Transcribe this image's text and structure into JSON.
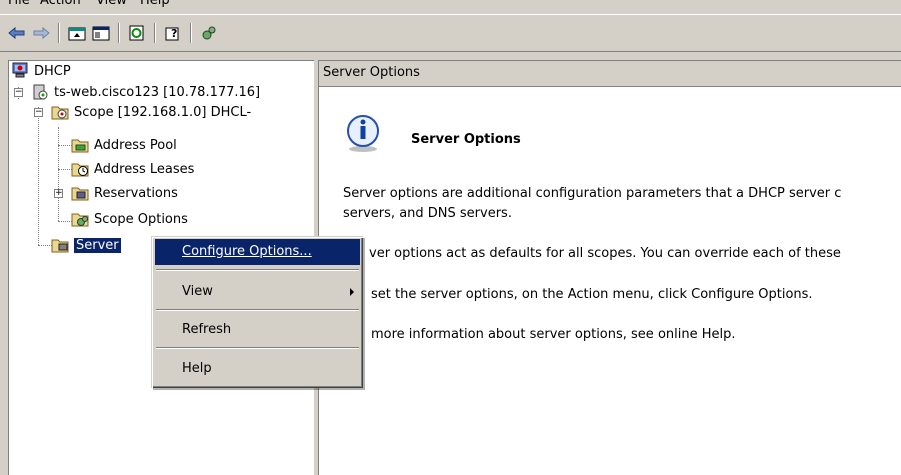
{
  "menubar": {
    "items": [
      "File",
      "Action",
      "View",
      "Help"
    ]
  },
  "toolbar": {
    "buttons": [
      "back-icon",
      "forward-icon",
      "up-folder-icon",
      "show-hide-tree-icon",
      "refresh-icon",
      "help-icon",
      "configure-icon"
    ]
  },
  "tree": {
    "root": "DHCP",
    "server": "ts-web.cisco123 [10.78.177.16]",
    "scope": "Scope [192.168.1.0] DHCL-",
    "address_pool": "Address Pool",
    "address_leases": "Address Leases",
    "reservations": "Reservations",
    "scope_options": "Scope Options",
    "server_options": "Server"
  },
  "detail": {
    "header": "Server Options",
    "title": "Server Options",
    "para1_line1": "Server options are additional configuration parameters that a DHCP server c",
    "para1_line2": "servers, and DNS servers.",
    "para2": "ver options act as defaults for all scopes.  You can override each of these",
    "para3": "set the server options, on the Action menu, click Configure Options.",
    "para4": "more information about server options, see online Help."
  },
  "context_menu": {
    "items": [
      "Configure Options...",
      "View",
      "Refresh",
      "Help"
    ],
    "selected": "Configure Options..."
  },
  "colors": {
    "selection": "#0a246a",
    "chrome": "#d4d0c8"
  }
}
